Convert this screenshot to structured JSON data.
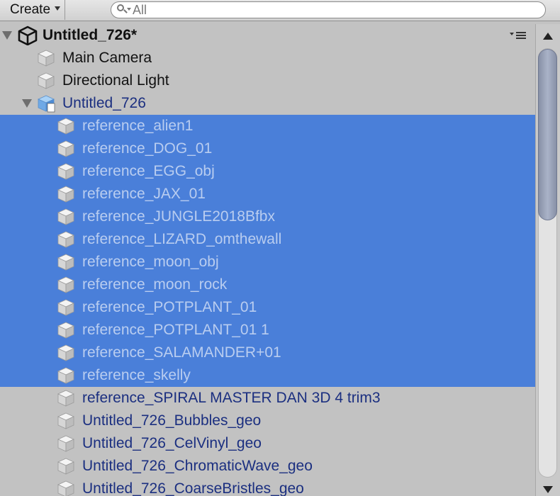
{
  "toolbar": {
    "create_label": "Create",
    "search_placeholder": "All"
  },
  "scene": {
    "name": "Untitled_726*"
  },
  "rows": [
    {
      "label": "Main Camera",
      "depth": 1,
      "style": "normal",
      "selected": false
    },
    {
      "label": "Directional Light",
      "depth": 1,
      "style": "normal",
      "selected": false
    },
    {
      "label": "Untitled_726",
      "depth": 1,
      "style": "prefab",
      "selected": false,
      "expandable": true,
      "prefab_root": true
    },
    {
      "label": "reference_alien1",
      "depth": 2,
      "style": "prefab",
      "selected": true
    },
    {
      "label": "reference_DOG_01",
      "depth": 2,
      "style": "prefab",
      "selected": true
    },
    {
      "label": "reference_EGG_obj",
      "depth": 2,
      "style": "prefab",
      "selected": true
    },
    {
      "label": "reference_JAX_01",
      "depth": 2,
      "style": "prefab",
      "selected": true
    },
    {
      "label": "reference_JUNGLE2018Bfbx",
      "depth": 2,
      "style": "prefab",
      "selected": true
    },
    {
      "label": "reference_LIZARD_omthewall",
      "depth": 2,
      "style": "prefab",
      "selected": true
    },
    {
      "label": "reference_moon_obj",
      "depth": 2,
      "style": "prefab",
      "selected": true
    },
    {
      "label": "reference_moon_rock",
      "depth": 2,
      "style": "prefab",
      "selected": true
    },
    {
      "label": "reference_POTPLANT_01",
      "depth": 2,
      "style": "prefab",
      "selected": true
    },
    {
      "label": "reference_POTPLANT_01 1",
      "depth": 2,
      "style": "prefab",
      "selected": true
    },
    {
      "label": "reference_SALAMANDER+01",
      "depth": 2,
      "style": "prefab",
      "selected": true
    },
    {
      "label": "reference_skelly",
      "depth": 2,
      "style": "prefab",
      "selected": true
    },
    {
      "label": "reference_SPIRAL MASTER DAN 3D 4 trim3",
      "depth": 2,
      "style": "prefab",
      "selected": false
    },
    {
      "label": "Untitled_726_Bubbles_geo",
      "depth": 2,
      "style": "prefab",
      "selected": false
    },
    {
      "label": "Untitled_726_CelVinyl_geo",
      "depth": 2,
      "style": "prefab",
      "selected": false
    },
    {
      "label": "Untitled_726_ChromaticWave_geo",
      "depth": 2,
      "style": "prefab",
      "selected": false
    },
    {
      "label": "Untitled_726_CoarseBristles_geo",
      "depth": 2,
      "style": "prefab",
      "selected": false
    }
  ],
  "icons": {
    "scene": "unity-logo-icon",
    "object": "cube-icon",
    "prefab_root": "prefab-cube-icon",
    "context_menu": "menu-icon"
  },
  "colors": {
    "selection": "#4a7fd9",
    "prefab_text": "#1b2f80",
    "selected_text": "#b9cdf0",
    "background": "#c2c2c2"
  },
  "scrollbar": {
    "position_fraction": 0,
    "visible_fraction": 0.4
  }
}
